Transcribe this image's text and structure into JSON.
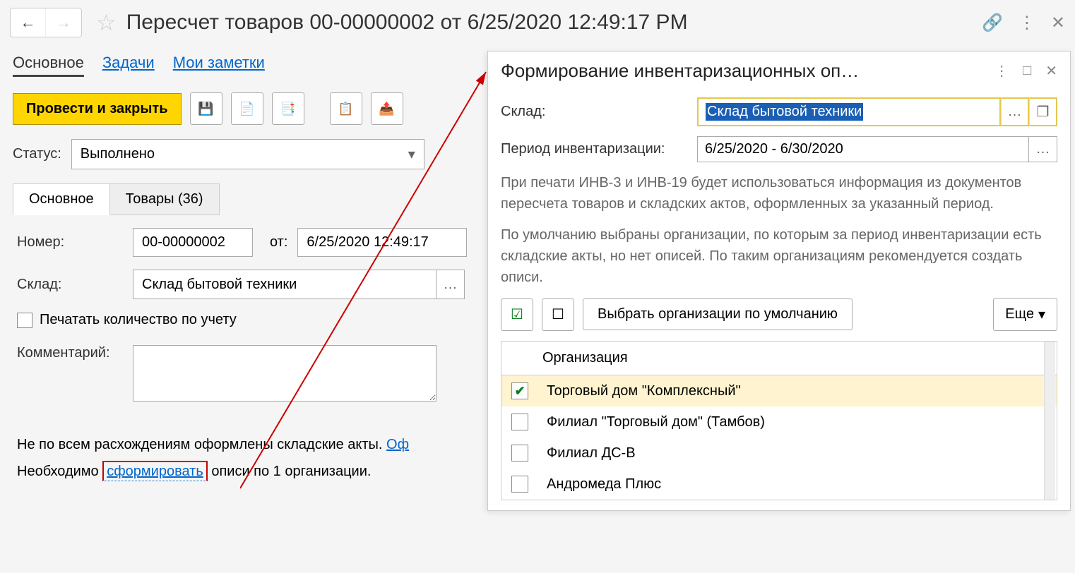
{
  "header": {
    "title": "Пересчет товаров 00-00000002 от 6/25/2020 12:49:17 PM"
  },
  "nav": {
    "tab_main": "Основное",
    "tab_tasks": "Задачи",
    "tab_notes": "Мои заметки"
  },
  "toolbar": {
    "primary": "Провести и закрыть"
  },
  "status": {
    "label": "Статус:",
    "value": "Выполнено"
  },
  "tabs2": {
    "main": "Основное",
    "goods": "Товары (36)"
  },
  "form": {
    "num_label": "Номер:",
    "num_value": "00-00000002",
    "from_label": "от:",
    "date_value": "6/25/2020 12:49:17",
    "wh_label": "Склад:",
    "wh_value": "Склад бытовой техники",
    "print_qty": "Печатать количество по учету",
    "comment_label": "Комментарий:"
  },
  "notice": {
    "line1_a": "Не по всем расхождениям оформлены складские акты. ",
    "line1_link": "Оф",
    "line2_a": "Необходимо ",
    "line2_link": "сформировать",
    "line2_b": " описи по 1 организации."
  },
  "dialog": {
    "title": "Формирование инвентаризационных оп…",
    "wh_label": "Склад:",
    "wh_value": "Склад бытовой техники",
    "period_label": "Период инвентаризации:",
    "period_value": "6/25/2020 - 6/30/2020",
    "info1": "При печати ИНВ-3 и ИНВ-19 будет использоваться информация из документов пересчета товаров и складских актов, оформленных за указанный период.",
    "info2": "По умолчанию выбраны организации, по которым за период инвентаризации есть складские акты, но нет описей. По таким организациям рекомендуется создать описи.",
    "select_default": "Выбрать организации по умолчанию",
    "more": "Еще",
    "org_header": "Организация",
    "orgs": [
      {
        "name": "Торговый дом \"Комплексный\"",
        "checked": true
      },
      {
        "name": "Филиал \"Торговый дом\" (Тамбов)",
        "checked": false
      },
      {
        "name": "Филиал ДС-В",
        "checked": false
      },
      {
        "name": "Андромеда Плюс",
        "checked": false
      }
    ]
  }
}
